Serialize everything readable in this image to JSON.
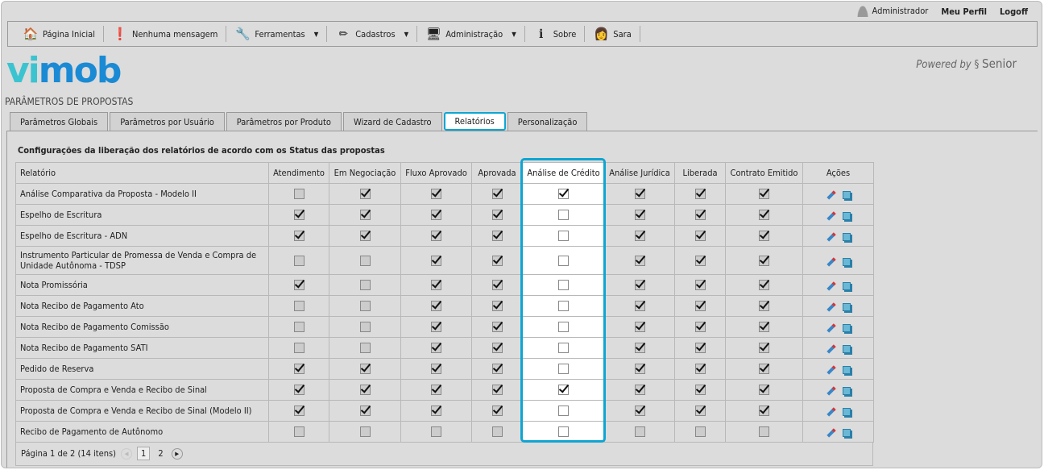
{
  "topbar": {
    "user": "Administrador",
    "profile": "Meu Perfil",
    "logoff": "Logoff"
  },
  "toolbar": [
    {
      "label": "Página Inicial",
      "icon": "home-icon",
      "glyph": "🏠",
      "menu": false
    },
    {
      "label": "Nenhuma mensagem",
      "icon": "alert-icon",
      "glyph": "❗",
      "menu": false
    },
    {
      "label": "Ferramentas",
      "icon": "wrench-icon",
      "glyph": "🔧",
      "menu": true
    },
    {
      "label": "Cadastros",
      "icon": "pencil-icon",
      "glyph": "✏",
      "menu": true
    },
    {
      "label": "Administração",
      "icon": "admin-monitor-icon",
      "glyph": "🖥",
      "menu": true
    },
    {
      "label": "Sobre",
      "icon": "info-icon",
      "glyph": "ℹ",
      "menu": false
    },
    {
      "label": "Sara",
      "icon": "assistant-avatar-icon",
      "glyph": "👩",
      "menu": false
    }
  ],
  "logo": {
    "text_a": "vi",
    "text_b": "mob"
  },
  "powered": {
    "prefix": "Powered by",
    "brand": "Senior"
  },
  "page_title": "PARÂMETROS DE PROPOSTAS",
  "tabs": [
    {
      "label": "Parâmetros Globais"
    },
    {
      "label": "Parâmetros por Usuário"
    },
    {
      "label": "Parâmetros por Produto"
    },
    {
      "label": "Wizard de Cadastro"
    },
    {
      "label": "Relatórios",
      "active": true
    },
    {
      "label": "Personalização"
    }
  ],
  "section_title": "Configurações da liberação dos relatórios de acordo com os Status das propostas",
  "table": {
    "columns": [
      "Relatório",
      "Atendimento",
      "Em Negociação",
      "Fluxo Aprovado",
      "Aprovada",
      "Análise de Crédito",
      "Análise Jurídica",
      "Liberada",
      "Contrato Emitido",
      "Ações"
    ],
    "highlight_column": 5,
    "rows": [
      {
        "name": "Análise Comparativa da Proposta - Modelo II",
        "checks": [
          0,
          1,
          1,
          1,
          1,
          1,
          1,
          1
        ]
      },
      {
        "name": "Espelho de Escritura",
        "checks": [
          1,
          1,
          1,
          1,
          0,
          1,
          1,
          1
        ]
      },
      {
        "name": "Espelho de Escritura - ADN",
        "checks": [
          1,
          1,
          1,
          1,
          0,
          1,
          1,
          1
        ]
      },
      {
        "name": "Instrumento Particular de Promessa de Venda e Compra de Unidade Autônoma - TDSP",
        "checks": [
          0,
          0,
          1,
          1,
          0,
          1,
          1,
          1
        ],
        "tall": true
      },
      {
        "name": "Nota Promissória",
        "checks": [
          1,
          0,
          1,
          1,
          0,
          1,
          1,
          1
        ]
      },
      {
        "name": "Nota Recibo de Pagamento Ato",
        "checks": [
          0,
          0,
          1,
          1,
          0,
          1,
          1,
          1
        ]
      },
      {
        "name": "Nota Recibo de Pagamento Comissão",
        "checks": [
          0,
          0,
          1,
          1,
          0,
          1,
          1,
          1
        ]
      },
      {
        "name": "Nota Recibo de Pagamento SATI",
        "checks": [
          0,
          0,
          1,
          1,
          0,
          1,
          1,
          1
        ]
      },
      {
        "name": "Pedido de Reserva",
        "checks": [
          1,
          1,
          1,
          1,
          0,
          1,
          1,
          1
        ]
      },
      {
        "name": "Proposta de Compra e Venda e Recibo de Sinal",
        "checks": [
          1,
          1,
          1,
          1,
          1,
          1,
          1,
          1
        ]
      },
      {
        "name": "Proposta de Compra e Venda e Recibo de Sinal (Modelo II)",
        "checks": [
          1,
          1,
          1,
          1,
          0,
          1,
          1,
          1
        ]
      },
      {
        "name": "Recibo de Pagamento de Autônomo",
        "checks": [
          0,
          0,
          0,
          0,
          0,
          0,
          0,
          0
        ]
      }
    ]
  },
  "pager": {
    "summary": "Página 1 de 2 (14 itens)",
    "pages": [
      "1",
      "2"
    ],
    "current": "1"
  }
}
